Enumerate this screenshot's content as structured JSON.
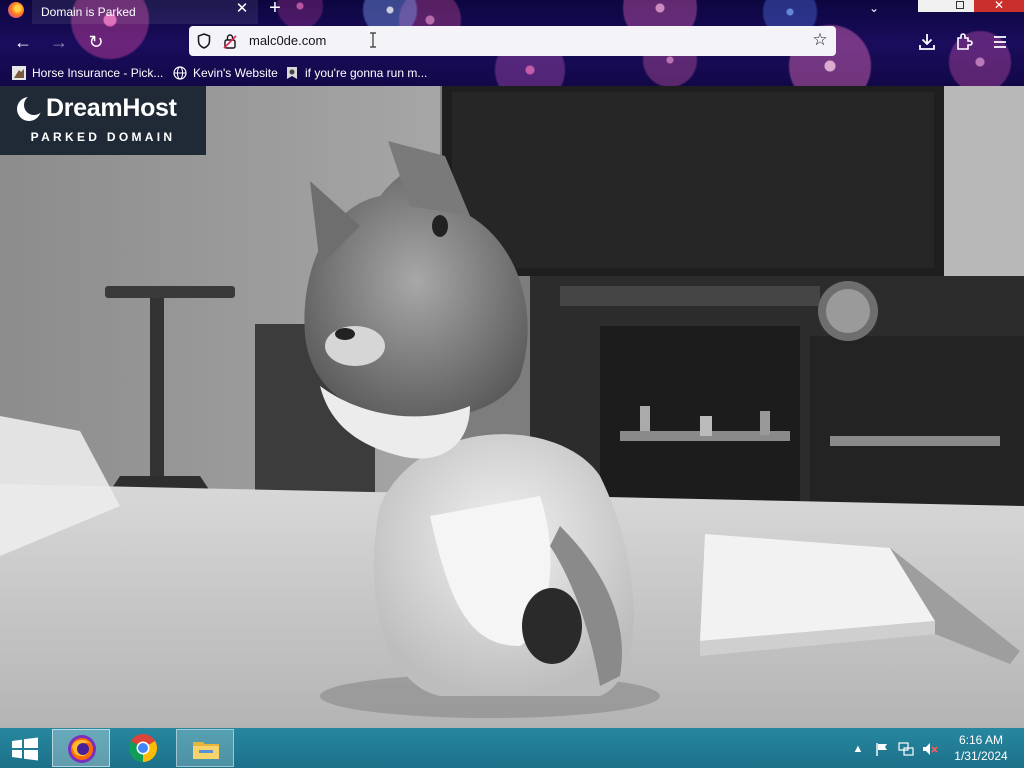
{
  "browser": {
    "tab": {
      "title": "Domain is Parked",
      "close_symbol": "✕"
    },
    "new_tab_symbol": "+",
    "list_tabs_symbol": "⌄",
    "window_close_symbol": "✕",
    "nav": {
      "back_symbol": "←",
      "forward_symbol": "→",
      "reload_symbol": "↻"
    },
    "url": "malc0de.com",
    "bookmark_star_symbol": "☆",
    "bookmarks": [
      {
        "label": "Horse Insurance - Pick...",
        "icon": "horse-favicon-icon"
      },
      {
        "label": "Kevin's Website",
        "icon": "globe-icon"
      },
      {
        "label": "if you're gonna run m...",
        "icon": "bookmark-favicon-icon"
      }
    ],
    "theme_colors": {
      "sky": "#120848",
      "firework_pink": "#ff78c8",
      "firework_blue": "#7aa6ff"
    }
  },
  "page": {
    "logo": {
      "brand": "DreamHost",
      "subtitle": "PARKED DOMAIN"
    },
    "background_image": "grayscale photo of a kitten sitting on a table"
  },
  "taskbar": {
    "apps": [
      {
        "name": "Firefox",
        "icon": "firefox-icon",
        "active": true
      },
      {
        "name": "Google Chrome",
        "icon": "chrome-icon",
        "active": false
      },
      {
        "name": "File Explorer",
        "icon": "file-explorer-icon",
        "active": false
      }
    ],
    "tray": {
      "show_hidden_symbol": "▲",
      "icons": [
        "flag-icon",
        "network-icon",
        "volume-muted-icon"
      ]
    },
    "clock": {
      "time": "6:16 AM",
      "date": "1/31/2024"
    },
    "color": "#1f7a92"
  }
}
